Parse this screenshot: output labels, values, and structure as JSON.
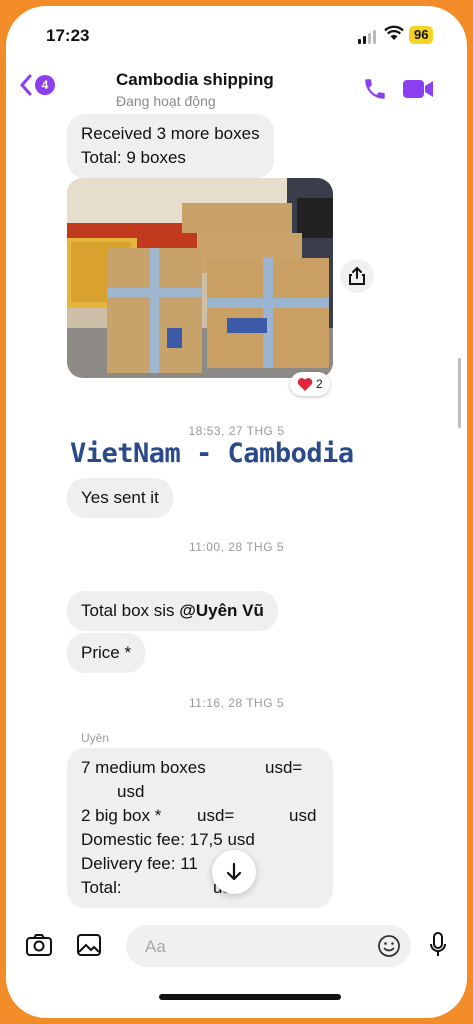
{
  "status_bar": {
    "time": "17:23",
    "battery": "96"
  },
  "header": {
    "back_badge": "4",
    "title": "Cambodia shipping",
    "subtitle": "Đang hoạt động"
  },
  "messages": {
    "received_lines": [
      "Received 3 more boxes",
      "Total: 9 boxes"
    ],
    "photo_reaction_count": "2",
    "timestamp_1": "18:53, 27 THG 5",
    "overlay_text": "VietNam - Cambodia",
    "yes_sent": "Yes sent it",
    "timestamp_2": "11:00, 28 THG 5",
    "total_box_prefix": "Total box sis ",
    "total_box_mention": "@Uyên Vũ",
    "price": "Price *",
    "timestamp_3": "11:16, 28 THG 5",
    "sender_name": "Uyên",
    "price_lines": {
      "l1a": "7 medium boxes",
      "l1b": "usd=",
      "l2": "usd",
      "l3a": "2 big box *",
      "l3b": "usd=",
      "l3c": "usd",
      "l4": "Domestic fee: 17,5 usd",
      "l5": "Delivery fee: 11",
      "l6a": "Total:",
      "l6b": "usd"
    }
  },
  "composer": {
    "placeholder": "Aa"
  },
  "colors": {
    "accent": "#8b3ff0",
    "bubble": "#efefef",
    "frame": "#f28c28"
  },
  "icons": [
    "back-chevron-icon",
    "phone-icon",
    "video-camera-icon",
    "share-icon",
    "heart-icon",
    "arrow-down-icon",
    "camera-icon",
    "image-icon",
    "emoji-icon",
    "microphone-icon"
  ]
}
